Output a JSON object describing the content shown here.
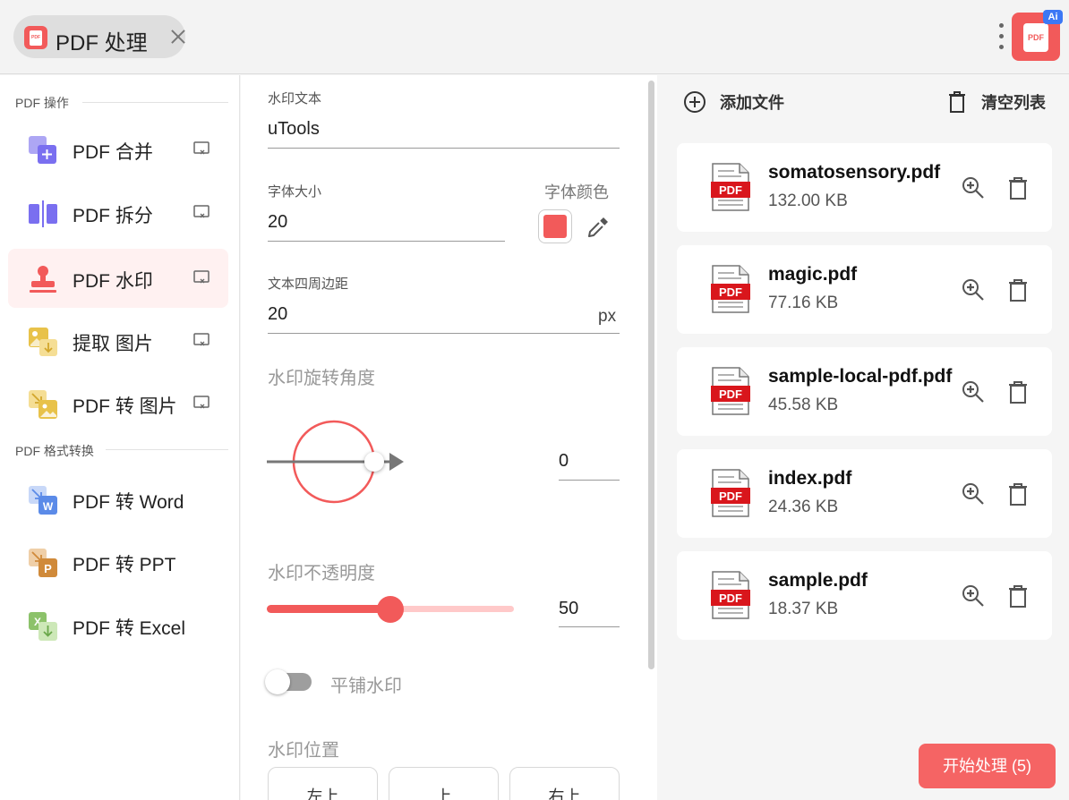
{
  "colors": {
    "accent": "#f25a5a",
    "active_bg": "#fff1f1",
    "slider_track": "#ffc9c9",
    "start_button": "#f56464",
    "ai_badge": "#3c78f5"
  },
  "tab": {
    "title": "PDF 处理",
    "icon": "pdf-icon",
    "close_icon": "close-icon"
  },
  "app_logo": {
    "label": "PDF",
    "badge": "Ai"
  },
  "sidebar": {
    "section1_title": "PDF 操作",
    "section2_title": "PDF 格式转换",
    "items": [
      {
        "label": "PDF 合并",
        "icon": "merge-icon",
        "active": false
      },
      {
        "label": "PDF 拆分",
        "icon": "split-icon",
        "active": false
      },
      {
        "label": "PDF 水印",
        "icon": "stamp-icon",
        "active": true
      },
      {
        "label": "提取 图片",
        "icon": "extract-image-icon",
        "active": false
      },
      {
        "label": "PDF 转 图片",
        "icon": "to-image-icon",
        "active": false
      },
      {
        "label": "PDF 转 Word",
        "icon": "to-word-icon",
        "active": false
      },
      {
        "label": "PDF 转 PPT",
        "icon": "to-ppt-icon",
        "active": false
      },
      {
        "label": "PDF 转 Excel",
        "icon": "to-excel-icon",
        "active": false
      }
    ]
  },
  "settings": {
    "watermark_text_label": "水印文本",
    "watermark_text_value": "uTools",
    "font_size_label": "字体大小",
    "font_size_value": "20",
    "font_color_label": "字体颜色",
    "font_color": "#f25a5a",
    "padding_label": "文本四周边距",
    "padding_value": "20",
    "padding_unit": "px",
    "rotation_label": "水印旋转角度",
    "rotation_value": "0",
    "opacity_label": "水印不透明度",
    "opacity_value": "50",
    "opacity_fraction": 0.5,
    "tile_label": "平铺水印",
    "tile_enabled": false,
    "position_label": "水印位置",
    "positions": [
      "左上",
      "上",
      "右上"
    ]
  },
  "files_panel": {
    "add_label": "添加文件",
    "clear_label": "清空列表",
    "files": [
      {
        "name": "somatosensory.pdf",
        "size": "132.00 KB"
      },
      {
        "name": "magic.pdf",
        "size": "77.16 KB"
      },
      {
        "name": "sample-local-pdf.pdf",
        "size": "45.58 KB"
      },
      {
        "name": "index.pdf",
        "size": "24.36 KB"
      },
      {
        "name": "sample.pdf",
        "size": "18.37 KB"
      }
    ],
    "file_badge": "PDF",
    "start_label": "开始处理 (5)"
  }
}
